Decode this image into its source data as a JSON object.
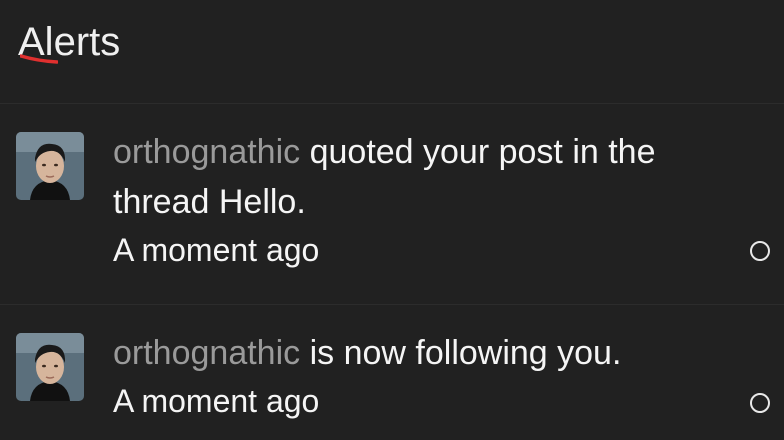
{
  "header": {
    "title": "Alerts"
  },
  "alerts": [
    {
      "username": "orthognathic",
      "message": " quoted your post in the thread Hello.",
      "time": "A moment ago",
      "avatar_icon": "user-avatar-icon",
      "read_marker_icon": "circle-outline-icon"
    },
    {
      "username": "orthognathic",
      "message": " is now following you.",
      "time": "A moment ago",
      "avatar_icon": "user-avatar-icon",
      "read_marker_icon": "circle-outline-icon"
    }
  ],
  "colors": {
    "background": "#212121",
    "divider": "#2c2c2c",
    "username": "#9a9a9a",
    "text": "#f5f5f5",
    "accent_swoosh": "#e0302f"
  }
}
